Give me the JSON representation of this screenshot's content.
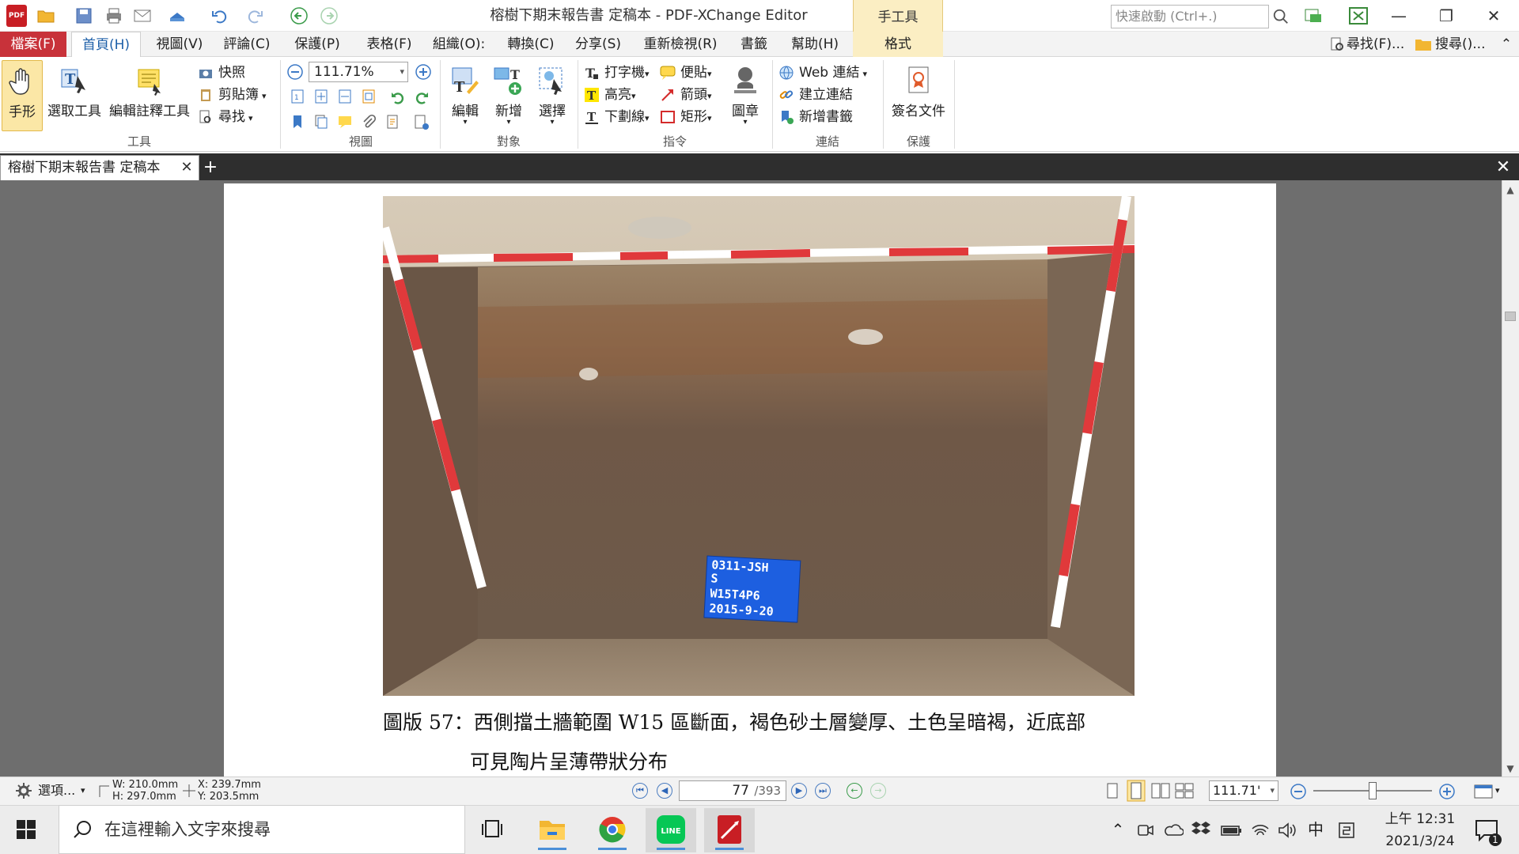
{
  "window": {
    "title": "榕樹下期末報告書 定稿本 - PDF-XChange Editor",
    "app_icon_text": "PDF",
    "context_group_title": "手工具",
    "quick_launch_placeholder": "快速啟動 (Ctrl+.)",
    "minimize": "—",
    "restore": "❐",
    "close": "✕"
  },
  "menu_tabs": {
    "file": "檔案(F)",
    "home": "首頁(H)",
    "view": "視圖(V)",
    "comment": "評論(C)",
    "protect": "保護(P)",
    "form": "表格(F)",
    "organize": "組織(O):",
    "convert": "轉換(C)",
    "share": "分享(S)",
    "review": "重新檢視(R)",
    "bookmark": "書籤",
    "help": "幫助(H)",
    "format": "格式",
    "find": "尋找(F)...",
    "search": "搜尋()...",
    "collapse": "⌃"
  },
  "ribbon": {
    "tools_group": {
      "label": "工具",
      "hand": "手形",
      "select": "選取工具",
      "edit_annot": "編輯註釋工具",
      "snapshot": "快照",
      "clipboard": "剪貼簿",
      "find": "尋找"
    },
    "view_group": {
      "label": "視圖",
      "zoom": "111.71%"
    },
    "object_group": {
      "label": "對象",
      "edit": "編輯",
      "add": "新增",
      "select": "選擇"
    },
    "command_group": {
      "label": "指令",
      "typewriter": "打字機",
      "sticky": "便貼",
      "highlight": "高亮",
      "arrow": "箭頭",
      "underline": "下劃線",
      "rectangle": "矩形",
      "stamp": "圖章"
    },
    "link_group": {
      "label": "連結",
      "web_link": "Web 連結",
      "create_link": "建立連結",
      "add_bookmark": "新增書籤"
    },
    "protect_group": {
      "label": "保護",
      "sign": "簽名文件"
    }
  },
  "doc_tab": {
    "label": "榕樹下期末報告書 定稿本",
    "close": "✕",
    "add": "+",
    "bar_close": "✕"
  },
  "document": {
    "caption_line1": "圖版 57：西側擋土牆範圍 W15 區斷面，褐色砂土層變厚、土色呈暗褐，近底部",
    "caption_line2": "可見陶片呈薄帶狀分布",
    "photo_board": [
      "0311-JSH",
      "S",
      "W15T4P6",
      "2015-9-20"
    ]
  },
  "statusbar": {
    "options": "選項...",
    "width": "W: 210.0mm",
    "height": "H: 297.0mm",
    "x": "X: 239.7mm",
    "y": "Y: 203.5mm",
    "page_current": "77",
    "page_total": "/393",
    "zoom": "111.71'"
  },
  "taskbar": {
    "search_placeholder": "在這裡輸入文字來搜尋",
    "ime": "中",
    "time": "上午 12:31",
    "date": "2021/3/24",
    "notification_count": "1"
  },
  "colors": {
    "accent_red": "#c8323a",
    "accent_blue": "#1d5fa8",
    "context_tab": "#fbeec3"
  }
}
